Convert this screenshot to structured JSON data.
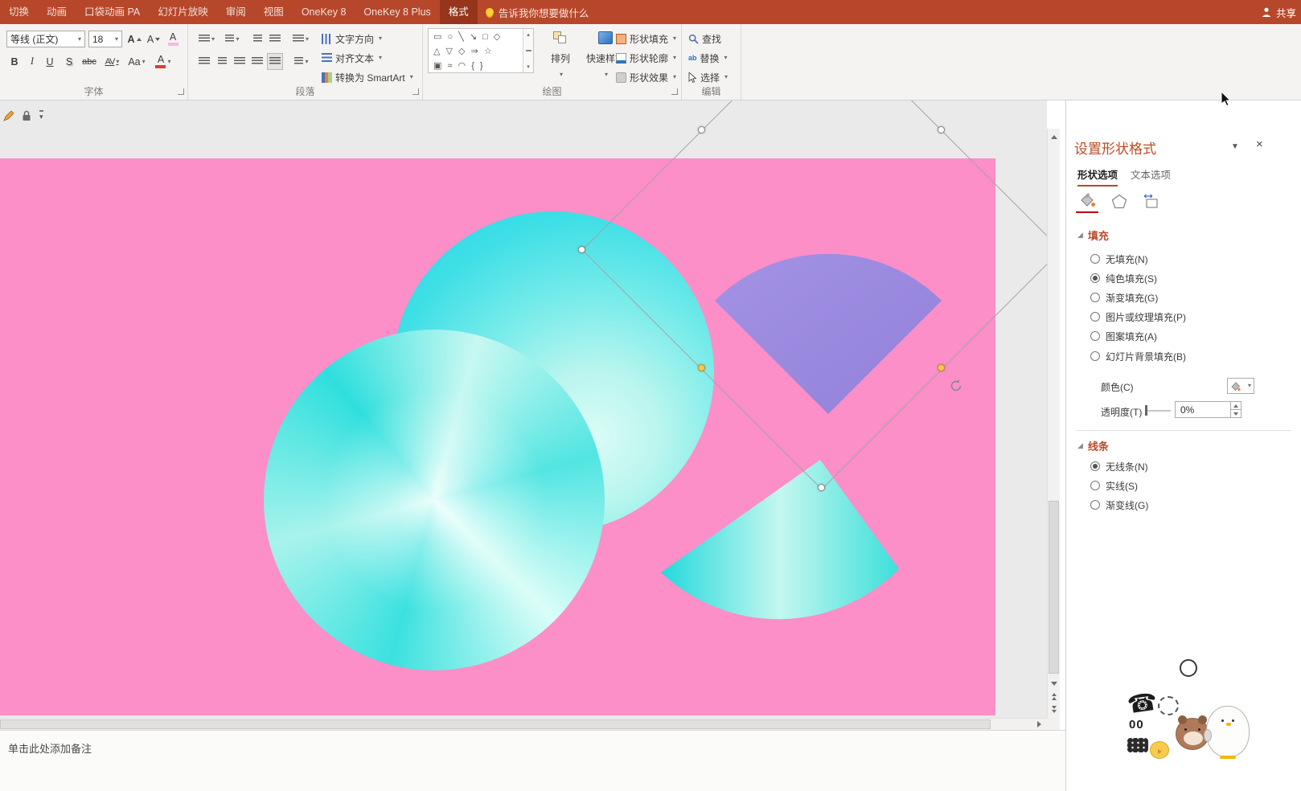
{
  "titlebar": {
    "tabs": [
      "切换",
      "动画",
      "口袋动画 PA",
      "幻灯片放映",
      "审阅",
      "视图",
      "OneKey 8",
      "OneKey 8 Plus",
      "格式"
    ],
    "active_tab": "格式",
    "tell_me": "告诉我你想要做什么",
    "share": "共享"
  },
  "ribbon": {
    "font": {
      "group_label": "字体",
      "family": "等线 (正文)",
      "size": "18",
      "grow": "A",
      "shrink": "A",
      "clear": "A",
      "bold": "B",
      "italic": "I",
      "underline": "U",
      "shadow": "S",
      "strikethrough": "abc",
      "spacing": "AV",
      "case": "Aa",
      "font_color": "A"
    },
    "paragraph": {
      "group_label": "段落",
      "text_direction": "文字方向",
      "align_text": "对齐文本",
      "smartart": "转换为 SmartArt"
    },
    "drawing": {
      "group_label": "绘图",
      "shape_rows": [
        "▭ ○ ╲ ↘ □ ◇",
        "△ ▽ ◇ ⇒ ☆",
        "▣ ≈ ◠ { }"
      ],
      "arrange": "排列",
      "quick_styles": "快速样式",
      "shape_fill": "形状填充",
      "shape_outline": "形状轮廓",
      "shape_effects": "形状效果"
    },
    "editing": {
      "group_label": "编辑",
      "find": "查找",
      "replace": "替换",
      "select": "选择",
      "replace_icon": "ab"
    }
  },
  "pane": {
    "title": "设置形状格式",
    "tabs": {
      "shape": "形状选项",
      "text": "文本选项"
    },
    "fill": {
      "title": "填充",
      "options": [
        {
          "label": "无填充(N)",
          "selected": false
        },
        {
          "label": "纯色填充(S)",
          "selected": true
        },
        {
          "label": "渐变填充(G)",
          "selected": false
        },
        {
          "label": "图片或纹理填充(P)",
          "selected": false
        },
        {
          "label": "图案填充(A)",
          "selected": false
        },
        {
          "label": "幻灯片背景填充(B)",
          "selected": false
        }
      ],
      "color_label": "颜色(C)",
      "transparency_label": "透明度(T)",
      "transparency_value": "0%"
    },
    "line": {
      "title": "线条",
      "options": [
        {
          "label": "无线条(N)",
          "selected": true
        },
        {
          "label": "实线(S)",
          "selected": false
        },
        {
          "label": "渐变线(G)",
          "selected": false
        }
      ]
    }
  },
  "notes": {
    "placeholder": "单击此处添加备注"
  },
  "stickers": {
    "digits": "00"
  },
  "glyphs": {
    "caret": "▾",
    "gallery_up": "▴",
    "gallery_down": "▾",
    "close": "×",
    "pane_caret": "▼",
    "phone": "☎",
    "section_tri": "◢"
  },
  "colors": {
    "accent_red": "#B7472A",
    "slide_pink": "#FC8EC8",
    "shape_cyan": "#29D9E6",
    "shape_cyan_light": "#D7FCF5",
    "shape_purple": "#9C8AE2"
  }
}
